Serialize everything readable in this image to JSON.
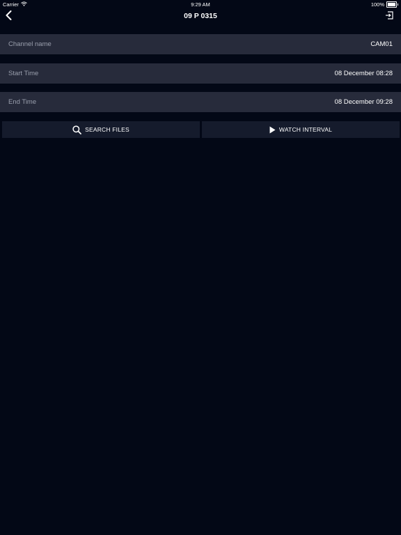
{
  "status_bar": {
    "carrier": "Carrier",
    "time": "9:29 AM",
    "battery": "100%"
  },
  "nav": {
    "title": "09 P 0315"
  },
  "fields": [
    {
      "label": "Channel name",
      "value": "CAM01"
    },
    {
      "label": "Start Time",
      "value": "08 December 08:28"
    },
    {
      "label": "End Time",
      "value": "08 December 09:28"
    }
  ],
  "actions": {
    "search_label": "SEARCH FILES",
    "watch_label": "WATCH INTERVAL"
  },
  "icons": {
    "back": "chevron-left-icon",
    "exit": "exit-icon",
    "search": "search-icon",
    "play": "play-icon",
    "wifi": "wifi-icon",
    "battery": "battery-icon"
  },
  "colors": {
    "background": "#030816",
    "row_background": "#272b3b",
    "button_background": "#151b2c",
    "label_text": "#9a9fad",
    "value_text": "#ffffff"
  }
}
